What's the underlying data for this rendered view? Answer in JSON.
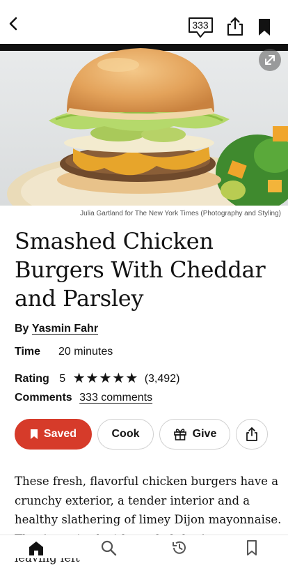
{
  "header": {
    "comment_count": "333"
  },
  "hero": {
    "credit": "Julia Gartland for The New York Times (Photography and Styling)"
  },
  "recipe": {
    "title": "Smashed Chicken Burgers With Cheddar and Parsley",
    "by_label": "By",
    "author": "Yasmin Fahr",
    "time_label": "Time",
    "time_value": "20 minutes",
    "rating_label": "Rating",
    "rating_value": "5",
    "stars": "★★★★★",
    "rating_count": "(3,492)",
    "comments_label": "Comments",
    "comments_link": "333 comments",
    "description": "These fresh, flavorful chicken burgers have a crunchy exterior, a tender interior and a healthy slathering of limey Dijon mayonnaise. They’re paired with a salad that’s a snap, leaving left"
  },
  "actions": {
    "saved": "Saved",
    "cook": "Cook",
    "give": "Give"
  },
  "icons": {
    "back": "chevron-left-icon",
    "comments": "speech-bubble-icon",
    "share": "share-icon",
    "bookmark": "bookmark-icon",
    "expand": "expand-icon",
    "home": "home-icon",
    "search": "search-icon",
    "history": "history-icon",
    "saved_tab": "bookmark-outline-icon"
  },
  "colors": {
    "accent": "#d63b2a",
    "text": "#121212"
  }
}
